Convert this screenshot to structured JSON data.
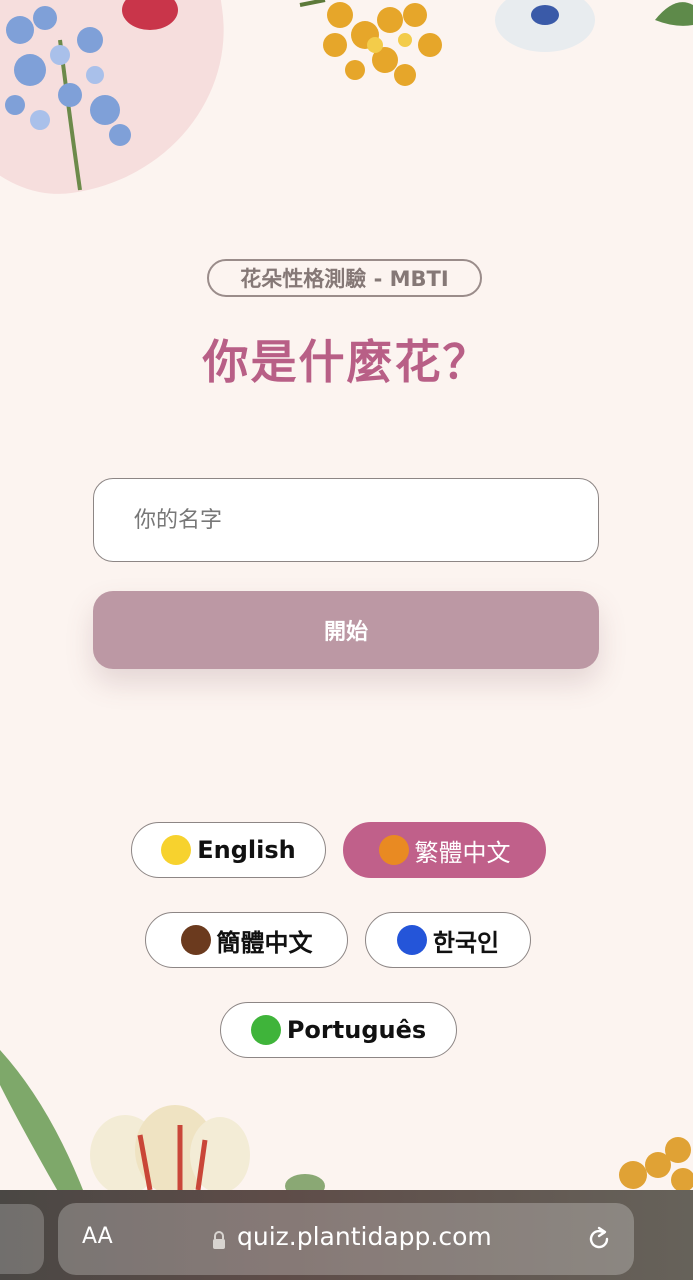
{
  "header": {
    "badge": "花朵性格測驗 - MBTI",
    "title": "你是什麼花？"
  },
  "form": {
    "name_placeholder": "你的名字",
    "start_label": "開始"
  },
  "languages": [
    {
      "label": "English",
      "dot_color": "#f7d22e",
      "selected": false
    },
    {
      "label": "繁體中文",
      "dot_color": "#e98a22",
      "selected": true
    },
    {
      "label": "簡體中文",
      "dot_color": "#6b3a1e",
      "selected": false
    },
    {
      "label": "한국인",
      "dot_color": "#2455d9",
      "selected": false
    },
    {
      "label": "Português",
      "dot_color": "#3fb43a",
      "selected": false
    }
  ],
  "browser": {
    "text_size_label": "AA",
    "url": "quiz.plantidapp.com"
  },
  "colors": {
    "background": "#fcf4f0",
    "accent": "#c0608a",
    "title": "#b85f86",
    "start_button": "#bc98a4"
  }
}
